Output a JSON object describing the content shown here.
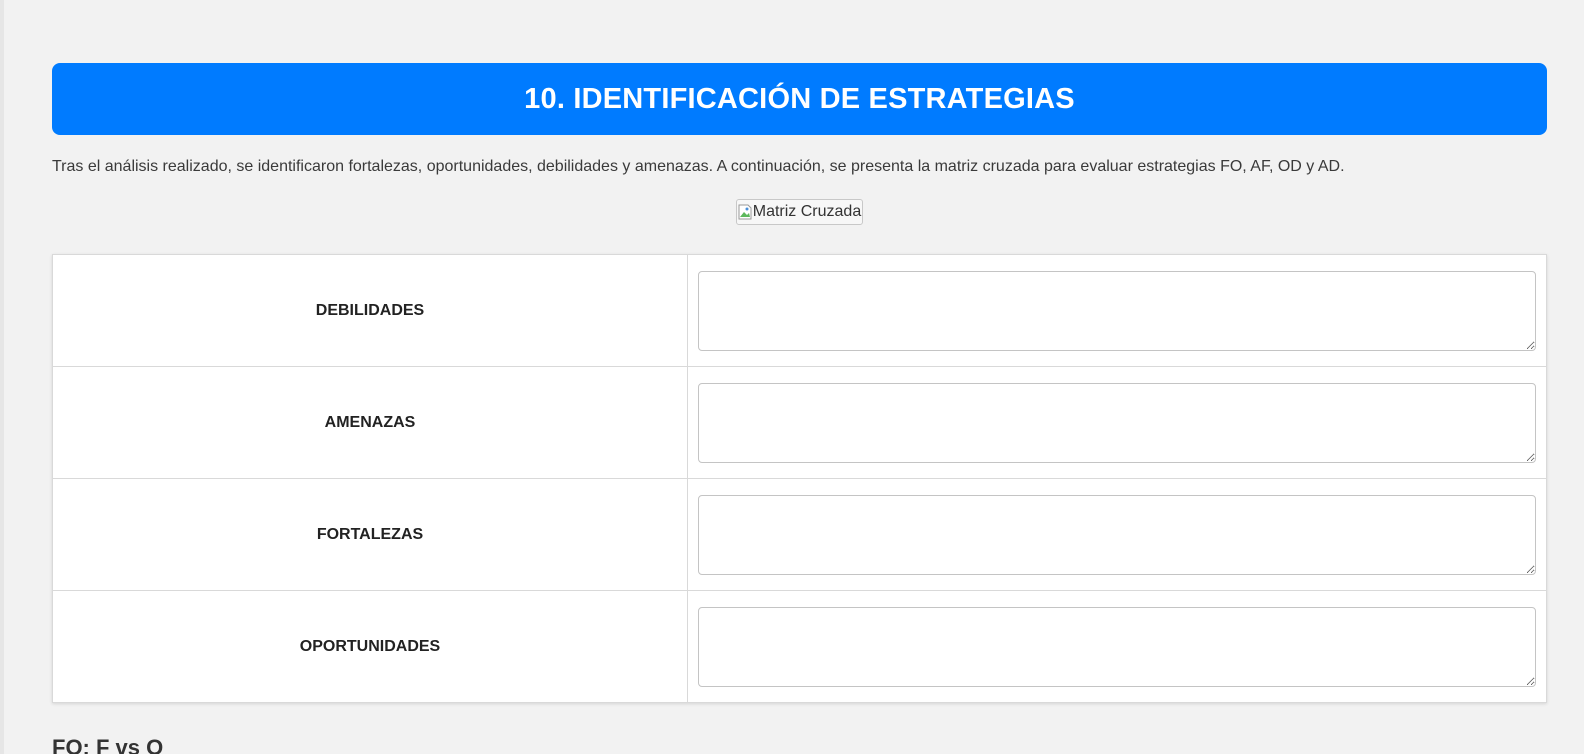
{
  "section": {
    "title": "10. IDENTIFICACIÓN DE ESTRATEGIAS",
    "intro": "Tras el análisis realizado, se identificaron fortalezas, oportunidades, debilidades y amenazas. A continuación, se presenta la matriz cruzada para evaluar estrategias FO, AF, OD y AD.",
    "image_alt": "Matriz Cruzada"
  },
  "matrix": {
    "rows": [
      {
        "label": "DEBILIDADES",
        "value": ""
      },
      {
        "label": "AMENAZAS",
        "value": ""
      },
      {
        "label": "FORTALEZAS",
        "value": ""
      },
      {
        "label": "OPORTUNIDADES",
        "value": ""
      }
    ]
  },
  "next_section": {
    "title": "FO: F vs O"
  },
  "colors": {
    "header_bg": "#007bff",
    "page_bg": "#f2f2f2"
  }
}
